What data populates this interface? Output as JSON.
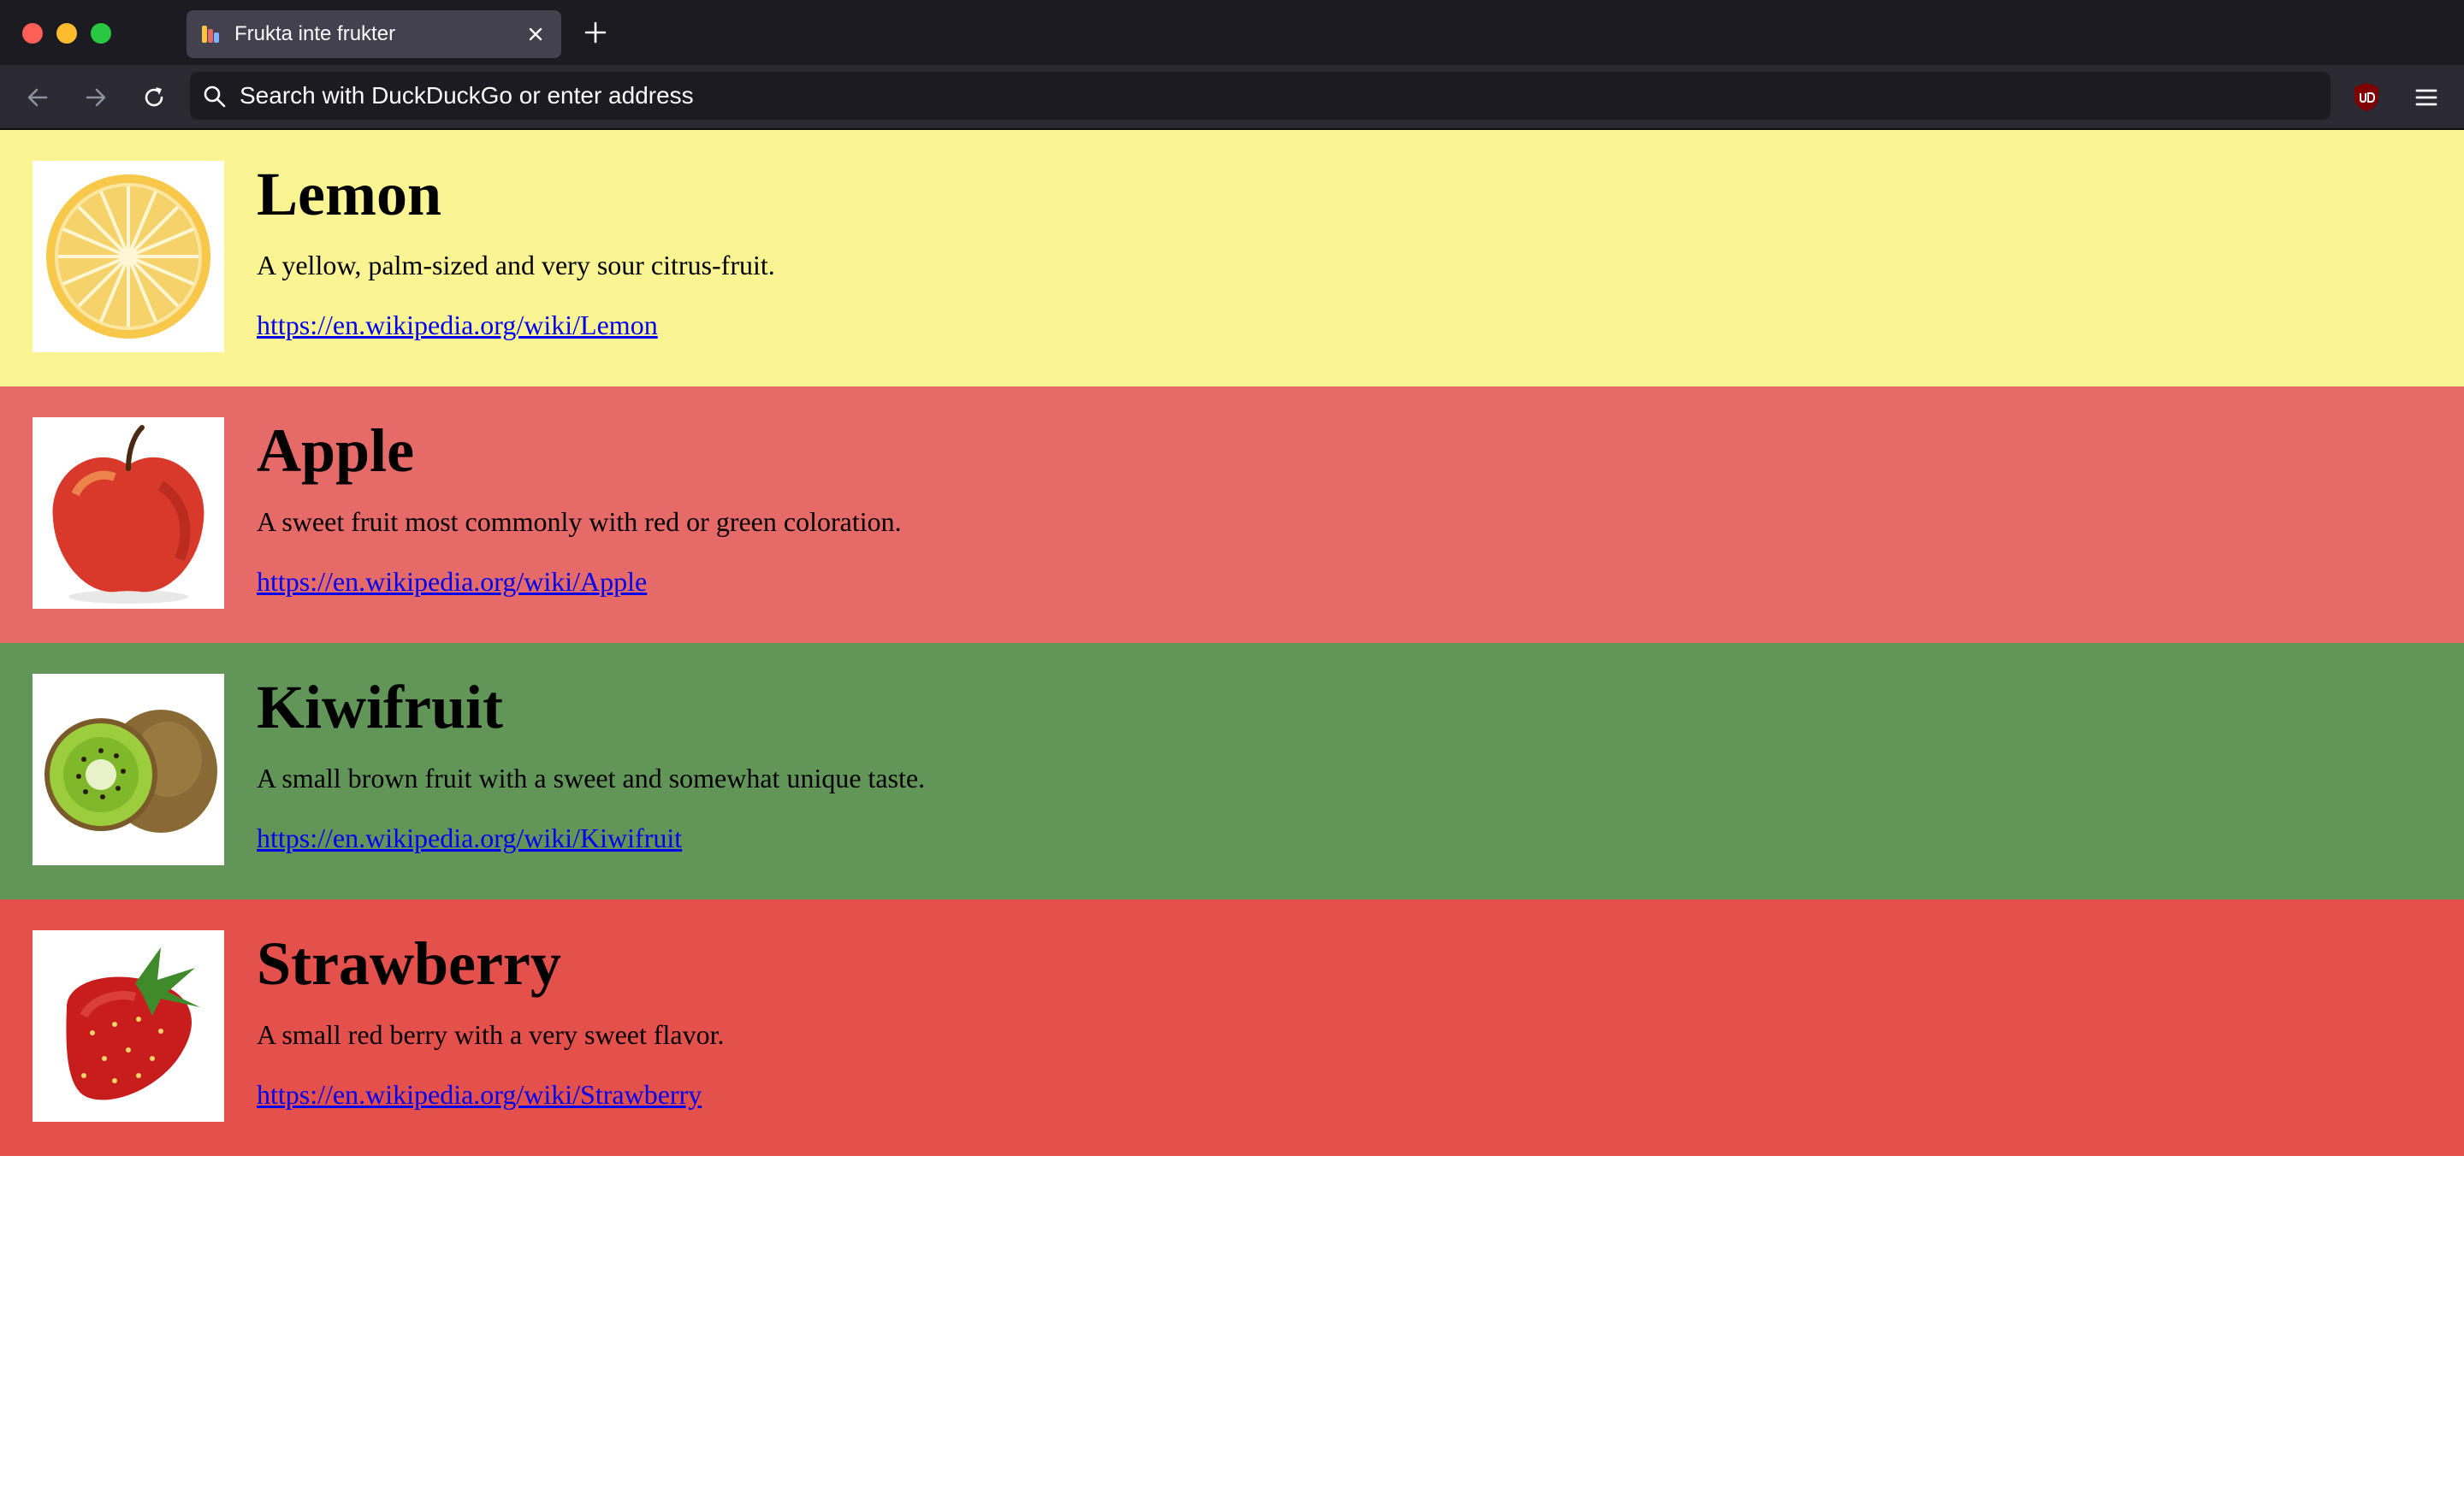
{
  "browser": {
    "tab_title": "Frukta inte frukter",
    "address_placeholder": "Search with DuckDuckGo or enter address",
    "colors": {
      "titlebar": "#1c1b22",
      "tab": "#42414d",
      "toolbar": "#2b2a33"
    }
  },
  "fruits": [
    {
      "name": "Lemon",
      "description": "A yellow, palm-sized and very sour citrus-fruit.",
      "link": "https://en.wikipedia.org/wiki/Lemon",
      "color": "#faf592",
      "image": "lemon-image"
    },
    {
      "name": "Apple",
      "description": "A sweet fruit most commonly with red or green coloration.",
      "link": "https://en.wikipedia.org/wiki/Apple",
      "color": "#e56a68",
      "image": "apple-image"
    },
    {
      "name": "Kiwifruit",
      "description": "A small brown fruit with a sweet and somewhat unique taste.",
      "link": "https://en.wikipedia.org/wiki/Kiwifruit",
      "color": "#629658",
      "image": "kiwifruit-image"
    },
    {
      "name": "Strawberry",
      "description": "A small red berry with a very sweet flavor.",
      "link": "https://en.wikipedia.org/wiki/Strawberry",
      "color": "#e4504b",
      "image": "strawberry-image"
    }
  ]
}
